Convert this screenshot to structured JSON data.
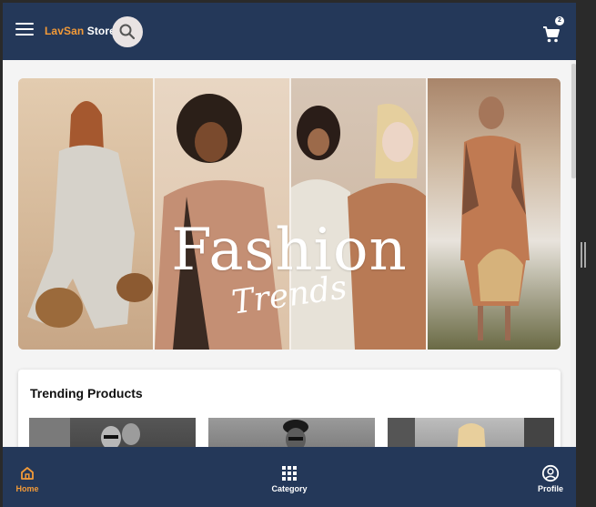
{
  "app": {
    "brand_part1": "LavSan",
    "brand_part2": "Store",
    "cart_count": "2"
  },
  "banner": {
    "title": "Fashion",
    "subtitle": "Trends"
  },
  "trending": {
    "title": "Trending Products"
  },
  "bottom_nav": {
    "home": "Home",
    "category": "Category",
    "profile": "Profile",
    "active": "Home"
  },
  "colors": {
    "header_bg": "#243859",
    "accent": "#f29a38",
    "page_bg": "#f4f4f4"
  }
}
